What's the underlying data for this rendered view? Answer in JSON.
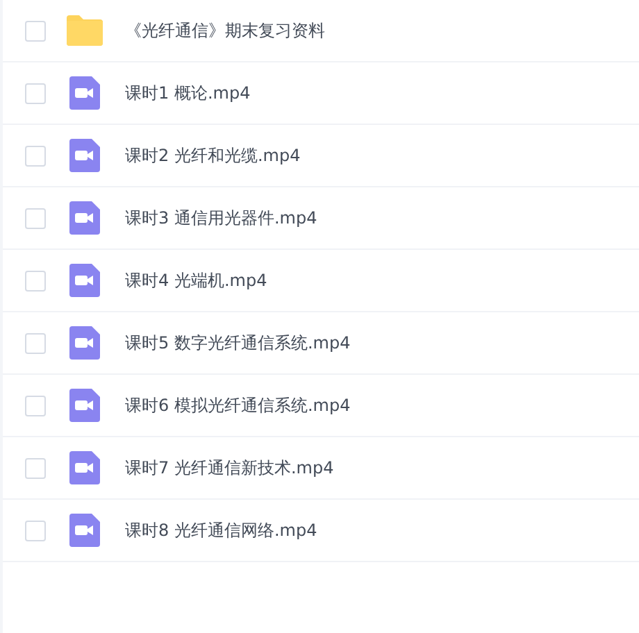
{
  "files": [
    {
      "kind": "folder",
      "name": "《光纤通信》期末复习资料",
      "checked": false
    },
    {
      "kind": "video",
      "name": "课时1 概论.mp4",
      "checked": false
    },
    {
      "kind": "video",
      "name": "课时2 光纤和光缆.mp4",
      "checked": false
    },
    {
      "kind": "video",
      "name": "课时3 通信用光器件.mp4",
      "checked": false
    },
    {
      "kind": "video",
      "name": "课时4 光端机.mp4",
      "checked": false
    },
    {
      "kind": "video",
      "name": "课时5 数字光纤通信系统.mp4",
      "checked": false
    },
    {
      "kind": "video",
      "name": "课时6 模拟光纤通信系统.mp4",
      "checked": false
    },
    {
      "kind": "video",
      "name": "课时7 光纤通信新技术.mp4",
      "checked": false
    },
    {
      "kind": "video",
      "name": "课时8 光纤通信网络.mp4",
      "checked": false
    }
  ]
}
